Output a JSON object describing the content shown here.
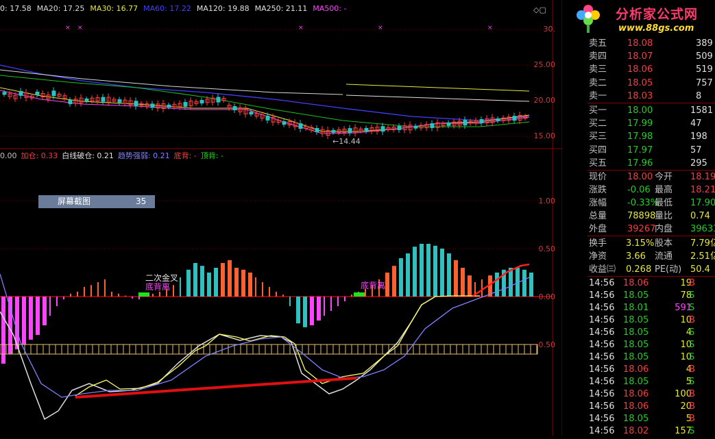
{
  "ma_line": [
    {
      "label": "0: 17.58",
      "color": "#e0e0e0"
    },
    {
      "label": "MA20: 17.25",
      "color": "#d8d8d8"
    },
    {
      "label": "MA30: 16.77",
      "color": "#e8e838"
    },
    {
      "label": "MA60: 17.22",
      "color": "#4040ff"
    },
    {
      "label": "MA120: 19.88",
      "color": "#e0e0e0"
    },
    {
      "label": "MA250: 21.11",
      "color": "#e0e0e0"
    },
    {
      "label": "MA500: -",
      "color": "#ff44ff"
    }
  ],
  "indicator_line": [
    {
      "label": "0.00",
      "color": "#c0c0c0"
    },
    {
      "label": "加仓: 0.33",
      "color": "#ff3b3b"
    },
    {
      "label": "白线破仓: 0.21",
      "color": "#e0e0e0"
    },
    {
      "label": "趋势强弱: 0.21",
      "color": "#8080ff"
    },
    {
      "label": "底背: -",
      "color": "#ff3b3b"
    },
    {
      "label": "顶背: -",
      "color": "#20d020"
    }
  ],
  "price_axis": [
    "30.",
    "25.00",
    "20.00",
    "15.00"
  ],
  "ind_axis": [
    "1.00",
    "0.50",
    "0.00",
    "-0.50"
  ],
  "low_marker": "←14.44",
  "screenshot_tool": {
    "label": "屏幕截图",
    "value": "35"
  },
  "annotations": {
    "golden_cross": "二次金叉",
    "bottom_divergence_1": "底背离",
    "bottom_divergence_2": "底背离"
  },
  "logo": {
    "title": "分析家公式网",
    "url": "www.88gs.com"
  },
  "order_book": {
    "asks": [
      {
        "label": "卖五",
        "price": "18.08",
        "vol": "389"
      },
      {
        "label": "卖四",
        "price": "18.07",
        "vol": "509"
      },
      {
        "label": "卖三",
        "price": "18.06",
        "vol": "519"
      },
      {
        "label": "卖二",
        "price": "18.05",
        "vol": "757"
      },
      {
        "label": "卖一",
        "price": "18.03",
        "vol": "8"
      }
    ],
    "bids": [
      {
        "label": "买一",
        "price": "18.00",
        "vol": "1581"
      },
      {
        "label": "买二",
        "price": "17.99",
        "vol": "47"
      },
      {
        "label": "买三",
        "price": "17.98",
        "vol": "198"
      },
      {
        "label": "买四",
        "price": "17.97",
        "vol": "57"
      },
      {
        "label": "买五",
        "price": "17.96",
        "vol": "295"
      }
    ]
  },
  "quote": [
    {
      "l1": "现价",
      "v1": "18.00",
      "c1": "red",
      "l2": "今开",
      "v2": "18.19",
      "c2": "red"
    },
    {
      "l1": "涨跌",
      "v1": "-0.06",
      "c1": "green",
      "l2": "最高",
      "v2": "18.21",
      "c2": "red"
    },
    {
      "l1": "涨幅",
      "v1": "-0.33%",
      "c1": "green",
      "l2": "最低",
      "v2": "17.90",
      "c2": "green"
    },
    {
      "l1": "总量",
      "v1": "78898",
      "c1": "yellow",
      "l2": "量比",
      "v2": "0.74",
      "c2": "yellow"
    },
    {
      "l1": "外盘",
      "v1": "39267",
      "c1": "red",
      "l2": "内盘",
      "v2": "39631",
      "c2": "green"
    }
  ],
  "finance": [
    {
      "l1": "换手",
      "v1": "3.15%",
      "l2": "股本",
      "v2": "7.79亿"
    },
    {
      "l1": "净资",
      "v1": "3.66",
      "l2": "流通",
      "v2": "2.51亿"
    },
    {
      "l1": "收益㈢",
      "v1": "0.268",
      "l2": "PE(动)",
      "v2": "50.4"
    }
  ],
  "ticks": [
    {
      "time": "14:56",
      "price": "18.06",
      "pc": "red",
      "vol": "19",
      "vc": "yellow",
      "side": "B"
    },
    {
      "time": "14:56",
      "price": "18.05",
      "pc": "green",
      "vol": "78",
      "vc": "yellow",
      "side": "S"
    },
    {
      "time": "14:56",
      "price": "18.01",
      "pc": "green",
      "vol": "591",
      "vc": "pink",
      "side": "S"
    },
    {
      "time": "14:56",
      "price": "18.05",
      "pc": "green",
      "vol": "10",
      "vc": "yellow",
      "side": "B"
    },
    {
      "time": "14:56",
      "price": "18.05",
      "pc": "green",
      "vol": "4",
      "vc": "yellow",
      "side": "S"
    },
    {
      "time": "14:56",
      "price": "18.05",
      "pc": "green",
      "vol": "10",
      "vc": "yellow",
      "side": "S"
    },
    {
      "time": "14:56",
      "price": "18.05",
      "pc": "green",
      "vol": "10",
      "vc": "yellow",
      "side": "S"
    },
    {
      "time": "14:56",
      "price": "18.06",
      "pc": "red",
      "vol": "4",
      "vc": "yellow",
      "side": "B"
    },
    {
      "time": "14:56",
      "price": "18.05",
      "pc": "green",
      "vol": "5",
      "vc": "yellow",
      "side": "S"
    },
    {
      "time": "14:56",
      "price": "18.06",
      "pc": "red",
      "vol": "100",
      "vc": "yellow",
      "side": "B"
    },
    {
      "time": "14:56",
      "price": "18.06",
      "pc": "red",
      "vol": "20",
      "vc": "yellow",
      "side": "B"
    },
    {
      "time": "14:56",
      "price": "18.05",
      "pc": "green",
      "vol": "5",
      "vc": "yellow",
      "side": "B"
    },
    {
      "time": "14:56",
      "price": "18.02",
      "pc": "red",
      "vol": "157",
      "vc": "yellow",
      "side": "S"
    }
  ],
  "chart_data": {
    "type": "line",
    "price_ylim": [
      13,
      31
    ],
    "indicator_ylim": [
      -0.9,
      1.3
    ],
    "histogram_x": [
      2,
      12,
      22,
      32,
      42,
      52,
      62,
      72,
      82,
      92,
      102,
      112,
      122,
      132,
      142,
      152,
      162,
      172,
      182,
      192,
      202,
      212,
      222,
      232,
      242,
      252,
      262,
      272,
      282,
      292,
      302,
      312,
      322,
      332,
      342,
      352,
      362,
      372,
      382,
      392,
      402,
      412,
      422,
      432,
      442,
      452,
      462,
      472,
      482,
      492,
      502,
      512,
      522,
      532,
      542,
      552,
      562,
      572,
      582,
      592,
      602,
      612,
      622,
      632,
      642,
      652,
      662,
      672,
      682,
      692,
      702,
      712,
      722,
      732,
      742,
      752,
      762,
      772
    ],
    "histogram": [
      -0.7,
      -0.6,
      -0.55,
      -0.5,
      -0.45,
      -0.4,
      -0.3,
      -0.2,
      -0.1,
      -0.03,
      0.03,
      0.05,
      0.1,
      0.12,
      0.15,
      0.18,
      0.05,
      0.03,
      0.01,
      -0.02,
      -0.03,
      0.0,
      0.03,
      0.05,
      0.08,
      0.12,
      0.2,
      0.28,
      0.35,
      0.32,
      0.25,
      0.3,
      0.35,
      0.38,
      0.3,
      0.28,
      0.25,
      0.2,
      0.15,
      0.1,
      0.05,
      0.02,
      -0.1,
      -0.28,
      -0.32,
      -0.3,
      -0.25,
      -0.2,
      -0.15,
      -0.1,
      -0.05,
      0.02,
      0.05,
      0.08,
      0.12,
      0.18,
      0.25,
      0.32,
      0.4,
      0.45,
      0.52,
      0.55,
      0.55,
      0.53,
      0.5,
      0.45,
      0.38,
      0.3,
      0.22,
      0.15,
      0.18,
      0.22,
      0.25,
      0.28,
      0.3,
      0.3,
      0.28,
      0.25
    ]
  }
}
